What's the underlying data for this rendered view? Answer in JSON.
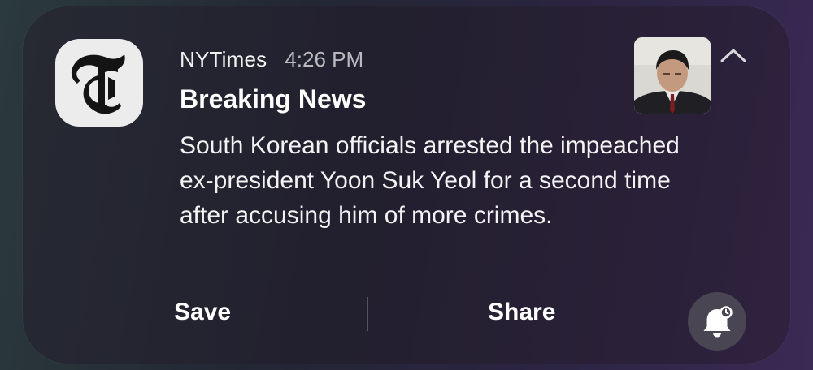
{
  "notification": {
    "app_name": "NYTimes",
    "time": "4:26 PM",
    "title": "Breaking News",
    "body": "South Korean officials arrested the impeached ex-president Yoon Suk Yeol for a second time after accusing him of more crimes.",
    "app_icon": "nytimes-t-logo-icon",
    "thumbnail": "news-photo-thumbnail",
    "collapse_icon": "chevron-up-icon"
  },
  "actions": {
    "save_label": "Save",
    "share_label": "Share",
    "snooze_icon": "bell-snooze-icon"
  },
  "colors": {
    "card_background": "#231f2e",
    "icon_background": "#ececec",
    "text_primary": "#ffffff",
    "text_secondary": "#b9b9c0",
    "bell_button": "#4a4553"
  }
}
